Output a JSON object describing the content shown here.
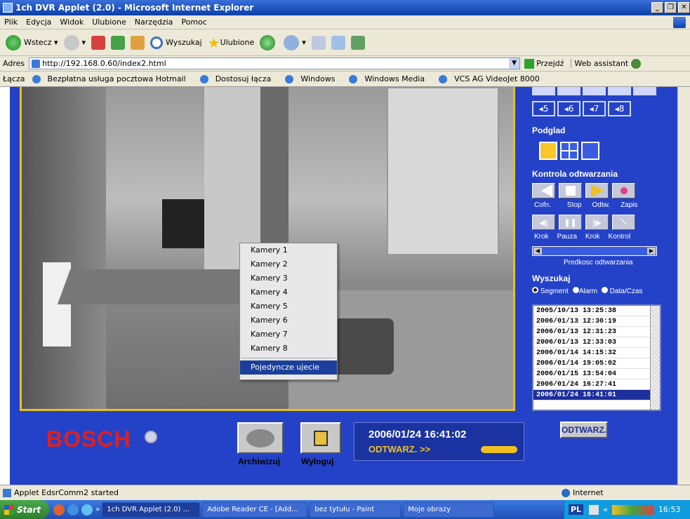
{
  "window": {
    "title": "1ch DVR Applet (2.0) - Microsoft Internet Explorer"
  },
  "menu": [
    "Plik",
    "Edycja",
    "Widok",
    "Ulubione",
    "Narzędzia",
    "Pomoc"
  ],
  "toolbar": {
    "back": "Wstecz",
    "search": "Wyszukaj",
    "favorites": "Ulubione"
  },
  "address": {
    "label": "Adres",
    "url": "http://192.168.0.60/index2.html",
    "go": "Przejdź",
    "assistant": "Web assistant"
  },
  "links": {
    "label": "Łącza",
    "items": [
      "Bezpłatna usługa pocztowa Hotmail",
      "Dostosuj łącza",
      "Windows",
      "Windows Media",
      "VCS AG VideoJet 8000"
    ]
  },
  "context_menu": {
    "items": [
      "Kamery 1",
      "Kamery 2",
      "Kamery 3",
      "Kamery 4",
      "Kamery 5",
      "Kamery 6",
      "Kamery 7",
      "Kamery 8"
    ],
    "selected": "Pojedyncze ujecie"
  },
  "right_panel": {
    "cameras": [
      "5",
      "6",
      "7",
      "8"
    ],
    "podglad": "Podglad",
    "kontrola": "Kontrola odtwarzania",
    "ctrl_labels1": [
      "Cofn.",
      "Stop",
      "Odtw.",
      "Zapis"
    ],
    "ctrl_labels2": [
      "Krok",
      "Pauza",
      "Krok",
      "Kontrol"
    ],
    "speed_label": "Predkosc odtwarzania",
    "wyszukaj": "Wyszukaj",
    "search_modes": [
      "Segment",
      "Alarm",
      "Data/Czas"
    ],
    "search_list": [
      "2005/10/13 13:25:38",
      "2006/01/13 12:30:19",
      "2006/01/13 12:31:23",
      "2006/01/13 12:33:03",
      "2006/01/14 14:15:32",
      "2006/01/14 19:05:02",
      "2006/01/15 13:54:04",
      "2006/01/24 16:27:41",
      "2006/01/24 16:41:01"
    ],
    "play_button": "ODTWARZ."
  },
  "bottom": {
    "brand": "BOSCH",
    "archive": "Archiwizuj",
    "logout": "Wyloguj",
    "datetime": "2006/01/24  16:41:02",
    "status": "ODTWARZ. >>"
  },
  "statusbar": {
    "text": "Applet EdsrComm2 started",
    "zone": "Internet"
  },
  "taskbar": {
    "start": "Start",
    "tasks": [
      "1ch DVR Applet (2.0) ...",
      "Adobe Reader CE - [Add...",
      "bez tytułu - Paint",
      "Moje obrazy"
    ],
    "lang": "PL",
    "time": "16:53"
  },
  "colors": {
    "panel": "#2442c8",
    "accent": "#f0c020",
    "brand": "#e02020"
  }
}
